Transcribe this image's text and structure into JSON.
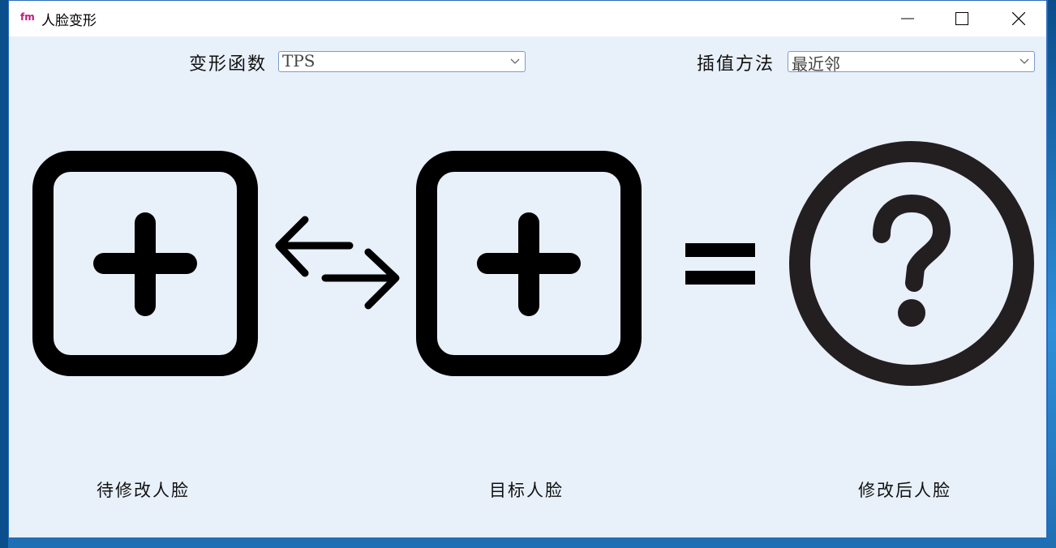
{
  "window": {
    "app_icon_text": "fm",
    "title": "人脸变形",
    "buttons": [
      "minimize",
      "maximize",
      "close"
    ]
  },
  "controls": {
    "warp_function": {
      "label": "变形函数",
      "value": "TPS"
    },
    "interpolation": {
      "label": "插值方法",
      "value": "最近邻"
    }
  },
  "panels": {
    "source": {
      "icon": "add-square-icon",
      "caption": "待修改人脸"
    },
    "swap": {
      "icon": "swap-arrows-icon"
    },
    "target": {
      "icon": "add-square-icon",
      "caption": "目标人脸"
    },
    "equals": {
      "icon": "equals-icon"
    },
    "result": {
      "icon": "question-circle-icon",
      "caption": "修改后人脸"
    }
  },
  "colors": {
    "window_bg": "#e8f0fa",
    "icon": "#000000",
    "question_icon": "#231f20"
  }
}
